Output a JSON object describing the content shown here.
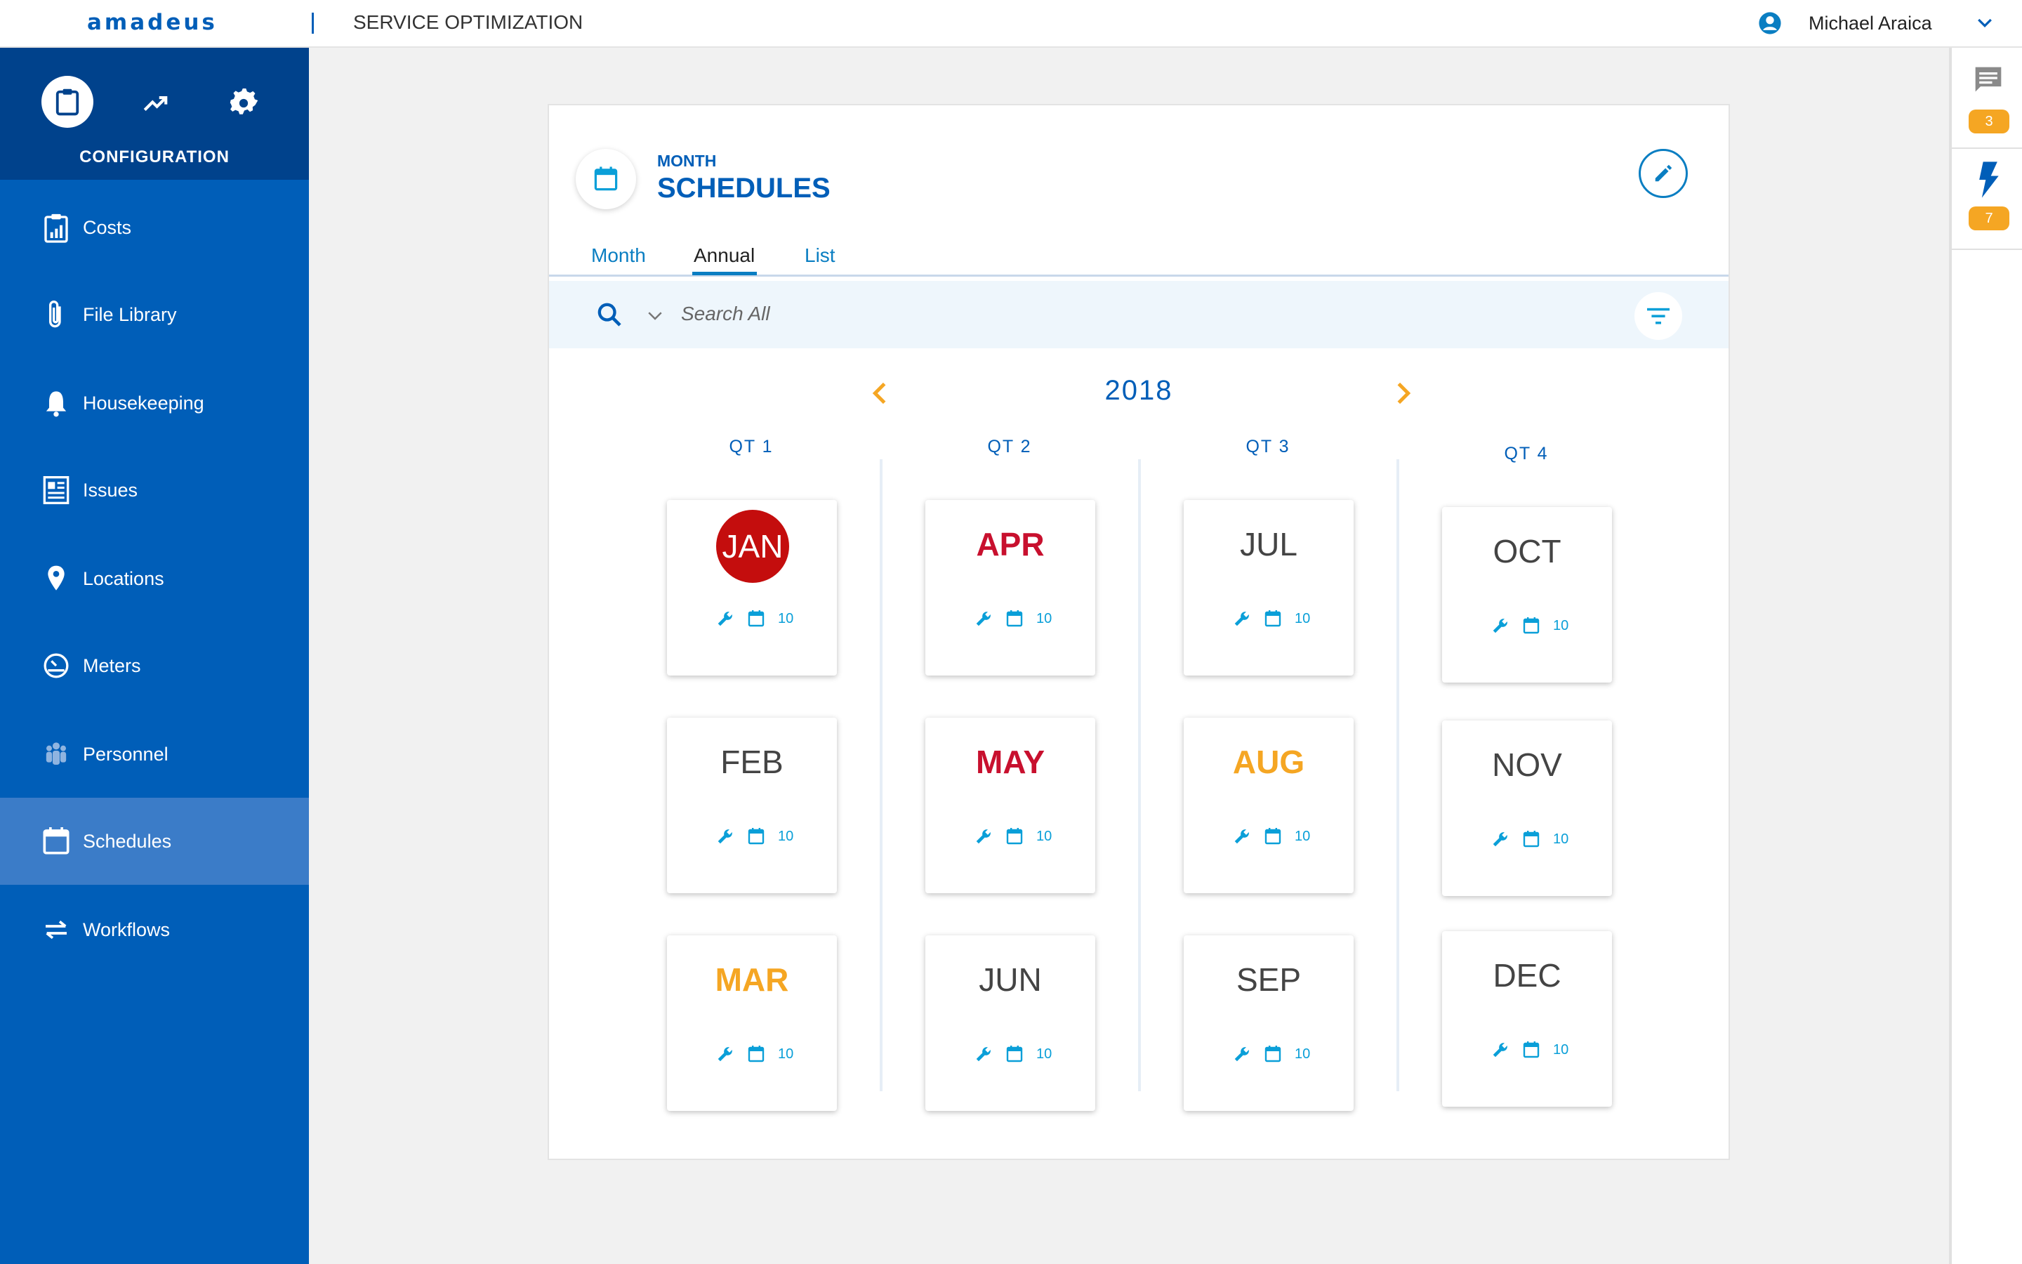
{
  "header": {
    "logo": "amadeus",
    "app_title": "SERVICE OPTIMIZATION",
    "user_name": "Michael Araica"
  },
  "sidebar": {
    "section_label": "CONFIGURATION",
    "items": [
      {
        "label": "Costs",
        "icon": "clipboard-chart-icon"
      },
      {
        "label": "File Library",
        "icon": "paperclip-icon"
      },
      {
        "label": "Housekeeping",
        "icon": "bell-icon"
      },
      {
        "label": "Issues",
        "icon": "document-list-icon"
      },
      {
        "label": "Locations",
        "icon": "location-pin-icon"
      },
      {
        "label": "Meters",
        "icon": "gauge-icon"
      },
      {
        "label": "Personnel",
        "icon": "people-icon"
      },
      {
        "label": "Schedules",
        "icon": "calendar-icon",
        "active": true
      },
      {
        "label": "Workflows",
        "icon": "swap-arrows-icon"
      }
    ]
  },
  "rail": {
    "messages_count": "3",
    "alerts_count": "7"
  },
  "card": {
    "subtitle": "MONTH",
    "title": "SCHEDULES",
    "tabs": [
      {
        "label": "Month"
      },
      {
        "label": "Annual",
        "active": true
      },
      {
        "label": "List"
      }
    ],
    "search_placeholder": "Search All",
    "year": "2018",
    "quarters": [
      "QT 1",
      "QT 2",
      "QT 3",
      "QT 4"
    ],
    "months": [
      {
        "name": "JAN",
        "style": "badge",
        "count": "10"
      },
      {
        "name": "FEB",
        "style": "normal",
        "count": "10"
      },
      {
        "name": "MAR",
        "style": "orange",
        "count": "10"
      },
      {
        "name": "APR",
        "style": "red",
        "count": "10"
      },
      {
        "name": "MAY",
        "style": "red",
        "count": "10"
      },
      {
        "name": "JUN",
        "style": "normal",
        "count": "10"
      },
      {
        "name": "JUL",
        "style": "normal",
        "count": "10"
      },
      {
        "name": "AUG",
        "style": "orange",
        "count": "10"
      },
      {
        "name": "SEP",
        "style": "normal",
        "count": "10"
      },
      {
        "name": "OCT",
        "style": "normal",
        "count": "10"
      },
      {
        "name": "NOV",
        "style": "normal",
        "count": "10"
      },
      {
        "name": "DEC",
        "style": "normal",
        "count": "10"
      }
    ]
  },
  "colors": {
    "brand_blue": "#005eb8",
    "sidebar_dark": "#00428c",
    "sidebar_active": "#3b7cc8",
    "accent_cyan": "#0a9fd8",
    "alert_red": "#c8102e",
    "warning_orange": "#f5a623"
  }
}
